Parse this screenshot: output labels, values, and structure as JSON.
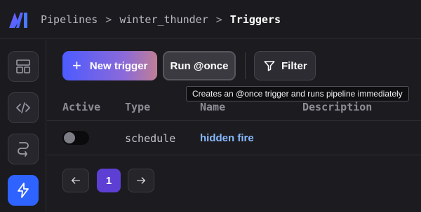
{
  "header": {
    "logo_icon": "mage-logo-icon",
    "breadcrumbs": [
      "Pipelines",
      "winter_thunder",
      "Triggers"
    ],
    "separator": ">"
  },
  "sidebar": {
    "items": [
      {
        "icon": "layout-icon",
        "active": false
      },
      {
        "icon": "code-icon",
        "active": false
      },
      {
        "icon": "route-icon",
        "active": false
      },
      {
        "icon": "lightning-icon",
        "active": true
      }
    ]
  },
  "toolbar": {
    "new_trigger_label": "New trigger",
    "run_once_label": "Run @once",
    "filter_label": "Filter",
    "tooltip": "Creates an @once trigger and runs pipeline immediately"
  },
  "table": {
    "columns": [
      "Active",
      "Type",
      "Name",
      "Description"
    ],
    "rows": [
      {
        "active": false,
        "type": "schedule",
        "name": "hidden fire",
        "description": ""
      }
    ]
  },
  "pagination": {
    "current_page": "1",
    "prev_icon": "arrow-left-icon",
    "next_icon": "arrow-right-icon"
  },
  "colors": {
    "accent_blue": "#2f63ff",
    "page_purple": "#5d3fd3",
    "link_blue": "#88b8ff"
  }
}
